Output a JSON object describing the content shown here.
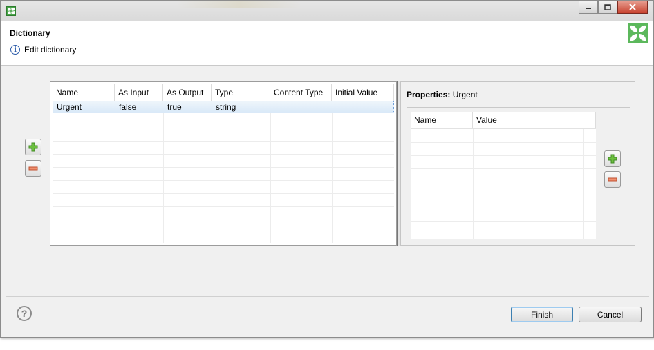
{
  "dialog": {
    "title": "Dictionary",
    "subtitle": "Edit dictionary"
  },
  "window_controls": {
    "minimize": "minimize-icon",
    "maximize": "maximize-icon",
    "close": "close-icon"
  },
  "entries_table": {
    "columns": [
      "Name",
      "As Input",
      "As Output",
      "Type",
      "Content Type",
      "Initial Value"
    ],
    "rows": [
      [
        "Urgent",
        "false",
        "true",
        "string",
        "",
        ""
      ]
    ]
  },
  "properties": {
    "label": "Properties:",
    "selected": "Urgent",
    "columns": [
      "Name",
      "Value"
    ]
  },
  "buttons": {
    "finish": "Finish",
    "cancel": "Cancel"
  },
  "colors": {
    "accent": "#5cb85c",
    "selection": "#d9e9f8",
    "add_icon": "#5aa83a",
    "remove_icon": "#e07a5f"
  }
}
